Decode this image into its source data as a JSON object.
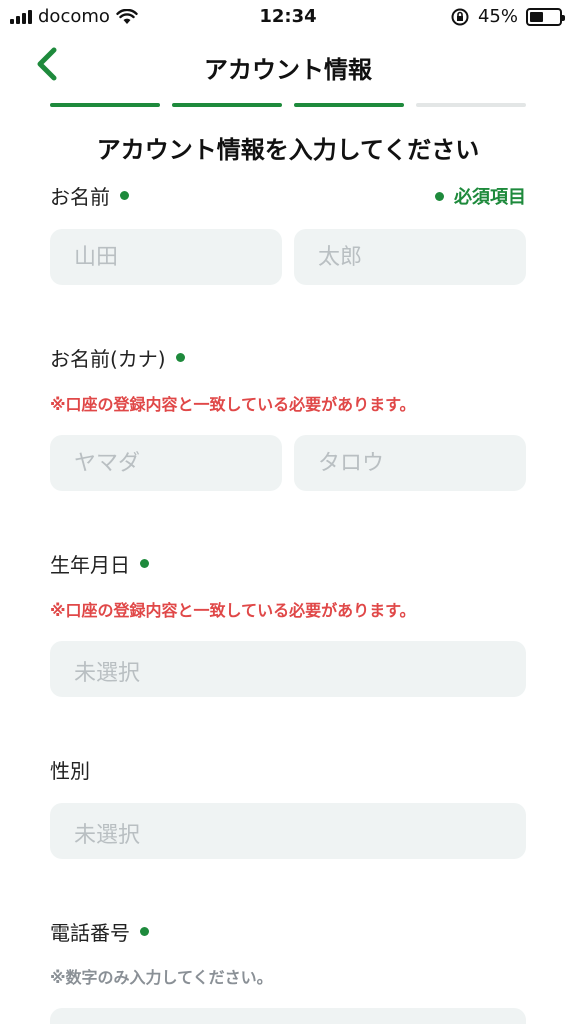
{
  "status_bar": {
    "carrier": "docomo",
    "time": "12:34",
    "battery": "45%",
    "battery_level": 0.45
  },
  "nav": {
    "title": "アカウント情報"
  },
  "progress": {
    "steps_total": 4,
    "steps_done": 3
  },
  "form": {
    "heading": "アカウント情報を入力してください",
    "required_note": "必須項目",
    "name": {
      "label": "お名前",
      "last_placeholder": "山田",
      "first_placeholder": "太郎"
    },
    "kana": {
      "label": "お名前(カナ)",
      "note": "※口座の登録内容と一致している必要があります。",
      "last_placeholder": "ヤマダ",
      "first_placeholder": "タロウ"
    },
    "birthday": {
      "label": "生年月日",
      "note": "※口座の登録内容と一致している必要があります。",
      "placeholder": "未選択"
    },
    "gender": {
      "label": "性別",
      "placeholder": "未選択"
    },
    "phone": {
      "label": "電話番号",
      "note": "※数字のみ入力してください。"
    }
  },
  "colors": {
    "accent": "#1e8a3c",
    "error": "#e04848",
    "field_bg": "#eff3f3"
  }
}
